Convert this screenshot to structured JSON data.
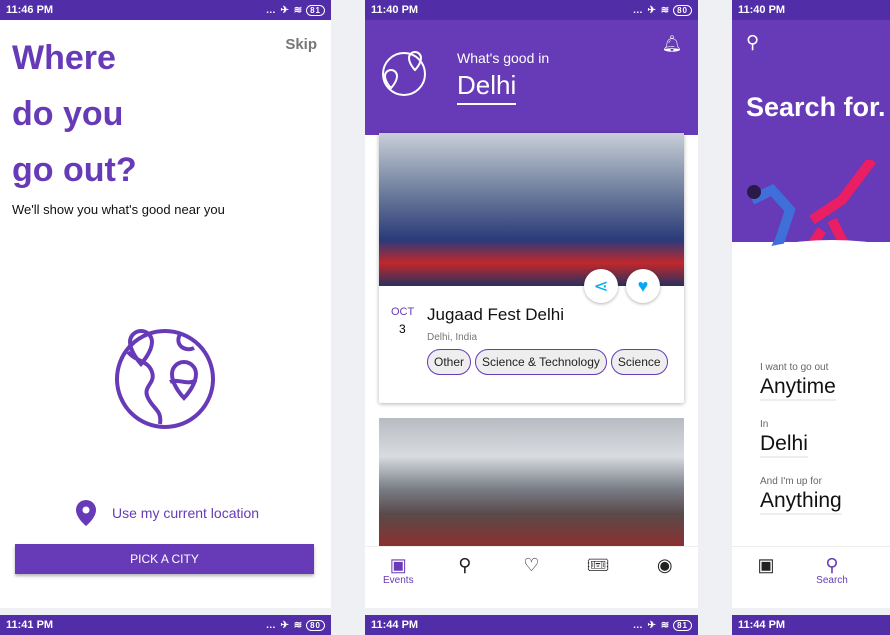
{
  "screens": [
    {
      "time": "11:46 PM",
      "battery": "81",
      "title_lines": [
        "Where",
        "do you",
        "go out?"
      ],
      "skip": "Skip",
      "subtitle": "We'll show you what's good near you",
      "use_location": "Use my current location",
      "pick_city": "PICK A CITY"
    },
    {
      "time": "11:40 PM",
      "battery": "80",
      "header_label": "What's good in",
      "city": "Delhi",
      "event": {
        "month": "OCT",
        "day": "3",
        "title": "Jugaad Fest Delhi",
        "location": "Delhi, India",
        "tags": [
          "Other",
          "Science & Technology",
          "Science"
        ]
      },
      "nav": [
        "Events",
        "",
        "",
        "",
        ""
      ]
    },
    {
      "time": "11:40 PM",
      "heading": "Search for. .",
      "fields": [
        {
          "label": "I want to go out",
          "value": "Anytime"
        },
        {
          "label": "In",
          "value": "Delhi"
        },
        {
          "label": "And I'm up for",
          "value": "Anything"
        }
      ],
      "nav_search": "Search"
    }
  ],
  "bottom_times": [
    "11:41 PM",
    "11:44 PM",
    "11:44 PM"
  ],
  "bottom_batteries": [
    "80",
    "81"
  ],
  "colors": {
    "primary": "#673ab7",
    "status_bar": "#512da8",
    "accent": "#03a9f4"
  }
}
